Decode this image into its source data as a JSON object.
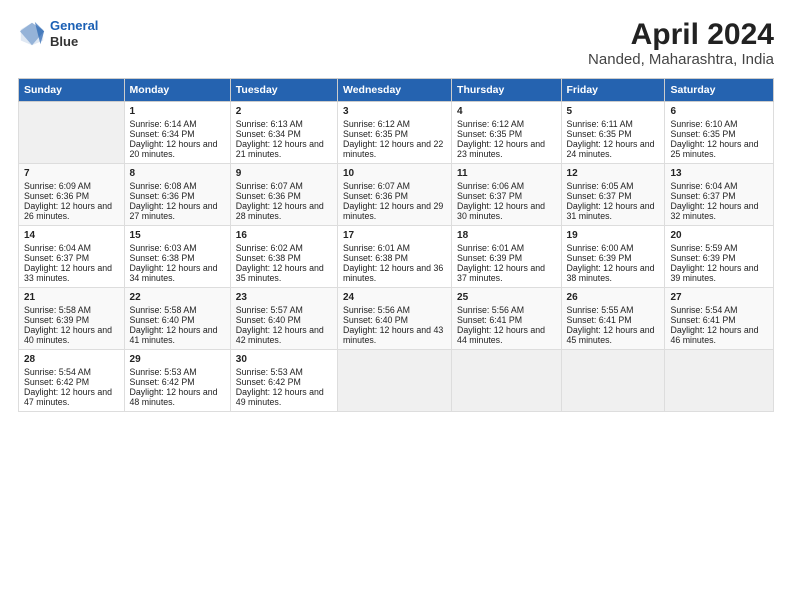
{
  "logo": {
    "line1": "General",
    "line2": "Blue"
  },
  "title": "April 2024",
  "subtitle": "Nanded, Maharashtra, India",
  "headers": [
    "Sunday",
    "Monday",
    "Tuesday",
    "Wednesday",
    "Thursday",
    "Friday",
    "Saturday"
  ],
  "weeks": [
    [
      {
        "day": "",
        "sunrise": "",
        "sunset": "",
        "daylight": ""
      },
      {
        "day": "1",
        "sunrise": "Sunrise: 6:14 AM",
        "sunset": "Sunset: 6:34 PM",
        "daylight": "Daylight: 12 hours and 20 minutes."
      },
      {
        "day": "2",
        "sunrise": "Sunrise: 6:13 AM",
        "sunset": "Sunset: 6:34 PM",
        "daylight": "Daylight: 12 hours and 21 minutes."
      },
      {
        "day": "3",
        "sunrise": "Sunrise: 6:12 AM",
        "sunset": "Sunset: 6:35 PM",
        "daylight": "Daylight: 12 hours and 22 minutes."
      },
      {
        "day": "4",
        "sunrise": "Sunrise: 6:12 AM",
        "sunset": "Sunset: 6:35 PM",
        "daylight": "Daylight: 12 hours and 23 minutes."
      },
      {
        "day": "5",
        "sunrise": "Sunrise: 6:11 AM",
        "sunset": "Sunset: 6:35 PM",
        "daylight": "Daylight: 12 hours and 24 minutes."
      },
      {
        "day": "6",
        "sunrise": "Sunrise: 6:10 AM",
        "sunset": "Sunset: 6:35 PM",
        "daylight": "Daylight: 12 hours and 25 minutes."
      }
    ],
    [
      {
        "day": "7",
        "sunrise": "Sunrise: 6:09 AM",
        "sunset": "Sunset: 6:36 PM",
        "daylight": "Daylight: 12 hours and 26 minutes."
      },
      {
        "day": "8",
        "sunrise": "Sunrise: 6:08 AM",
        "sunset": "Sunset: 6:36 PM",
        "daylight": "Daylight: 12 hours and 27 minutes."
      },
      {
        "day": "9",
        "sunrise": "Sunrise: 6:07 AM",
        "sunset": "Sunset: 6:36 PM",
        "daylight": "Daylight: 12 hours and 28 minutes."
      },
      {
        "day": "10",
        "sunrise": "Sunrise: 6:07 AM",
        "sunset": "Sunset: 6:36 PM",
        "daylight": "Daylight: 12 hours and 29 minutes."
      },
      {
        "day": "11",
        "sunrise": "Sunrise: 6:06 AM",
        "sunset": "Sunset: 6:37 PM",
        "daylight": "Daylight: 12 hours and 30 minutes."
      },
      {
        "day": "12",
        "sunrise": "Sunrise: 6:05 AM",
        "sunset": "Sunset: 6:37 PM",
        "daylight": "Daylight: 12 hours and 31 minutes."
      },
      {
        "day": "13",
        "sunrise": "Sunrise: 6:04 AM",
        "sunset": "Sunset: 6:37 PM",
        "daylight": "Daylight: 12 hours and 32 minutes."
      }
    ],
    [
      {
        "day": "14",
        "sunrise": "Sunrise: 6:04 AM",
        "sunset": "Sunset: 6:37 PM",
        "daylight": "Daylight: 12 hours and 33 minutes."
      },
      {
        "day": "15",
        "sunrise": "Sunrise: 6:03 AM",
        "sunset": "Sunset: 6:38 PM",
        "daylight": "Daylight: 12 hours and 34 minutes."
      },
      {
        "day": "16",
        "sunrise": "Sunrise: 6:02 AM",
        "sunset": "Sunset: 6:38 PM",
        "daylight": "Daylight: 12 hours and 35 minutes."
      },
      {
        "day": "17",
        "sunrise": "Sunrise: 6:01 AM",
        "sunset": "Sunset: 6:38 PM",
        "daylight": "Daylight: 12 hours and 36 minutes."
      },
      {
        "day": "18",
        "sunrise": "Sunrise: 6:01 AM",
        "sunset": "Sunset: 6:39 PM",
        "daylight": "Daylight: 12 hours and 37 minutes."
      },
      {
        "day": "19",
        "sunrise": "Sunrise: 6:00 AM",
        "sunset": "Sunset: 6:39 PM",
        "daylight": "Daylight: 12 hours and 38 minutes."
      },
      {
        "day": "20",
        "sunrise": "Sunrise: 5:59 AM",
        "sunset": "Sunset: 6:39 PM",
        "daylight": "Daylight: 12 hours and 39 minutes."
      }
    ],
    [
      {
        "day": "21",
        "sunrise": "Sunrise: 5:58 AM",
        "sunset": "Sunset: 6:39 PM",
        "daylight": "Daylight: 12 hours and 40 minutes."
      },
      {
        "day": "22",
        "sunrise": "Sunrise: 5:58 AM",
        "sunset": "Sunset: 6:40 PM",
        "daylight": "Daylight: 12 hours and 41 minutes."
      },
      {
        "day": "23",
        "sunrise": "Sunrise: 5:57 AM",
        "sunset": "Sunset: 6:40 PM",
        "daylight": "Daylight: 12 hours and 42 minutes."
      },
      {
        "day": "24",
        "sunrise": "Sunrise: 5:56 AM",
        "sunset": "Sunset: 6:40 PM",
        "daylight": "Daylight: 12 hours and 43 minutes."
      },
      {
        "day": "25",
        "sunrise": "Sunrise: 5:56 AM",
        "sunset": "Sunset: 6:41 PM",
        "daylight": "Daylight: 12 hours and 44 minutes."
      },
      {
        "day": "26",
        "sunrise": "Sunrise: 5:55 AM",
        "sunset": "Sunset: 6:41 PM",
        "daylight": "Daylight: 12 hours and 45 minutes."
      },
      {
        "day": "27",
        "sunrise": "Sunrise: 5:54 AM",
        "sunset": "Sunset: 6:41 PM",
        "daylight": "Daylight: 12 hours and 46 minutes."
      }
    ],
    [
      {
        "day": "28",
        "sunrise": "Sunrise: 5:54 AM",
        "sunset": "Sunset: 6:42 PM",
        "daylight": "Daylight: 12 hours and 47 minutes."
      },
      {
        "day": "29",
        "sunrise": "Sunrise: 5:53 AM",
        "sunset": "Sunset: 6:42 PM",
        "daylight": "Daylight: 12 hours and 48 minutes."
      },
      {
        "day": "30",
        "sunrise": "Sunrise: 5:53 AM",
        "sunset": "Sunset: 6:42 PM",
        "daylight": "Daylight: 12 hours and 49 minutes."
      },
      {
        "day": "",
        "sunrise": "",
        "sunset": "",
        "daylight": ""
      },
      {
        "day": "",
        "sunrise": "",
        "sunset": "",
        "daylight": ""
      },
      {
        "day": "",
        "sunrise": "",
        "sunset": "",
        "daylight": ""
      },
      {
        "day": "",
        "sunrise": "",
        "sunset": "",
        "daylight": ""
      }
    ]
  ]
}
